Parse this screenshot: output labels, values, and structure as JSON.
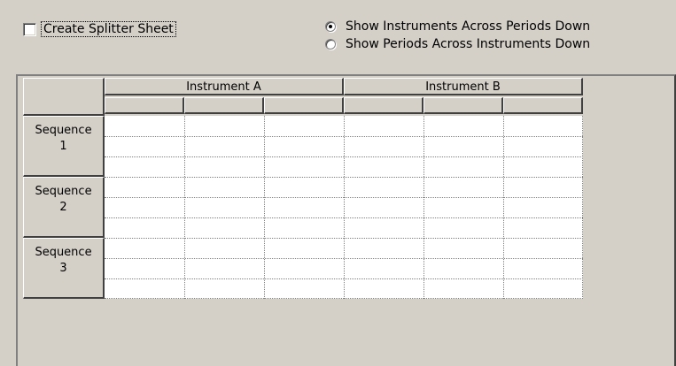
{
  "options": {
    "create_splitter_label": "Create Splitter Sheet",
    "create_splitter_checked": false,
    "radio_across_periods": "Show Instruments Across Periods Down",
    "radio_across_instruments": "Show Periods Across Instruments Down",
    "selected_radio": "across_periods"
  },
  "grid": {
    "instruments": [
      "Instrument A",
      "Instrument B"
    ],
    "sequences": [
      {
        "line1": "Sequence",
        "line2": "1"
      },
      {
        "line1": "Sequence",
        "line2": "2"
      },
      {
        "line1": "Sequence",
        "line2": "3"
      }
    ]
  }
}
